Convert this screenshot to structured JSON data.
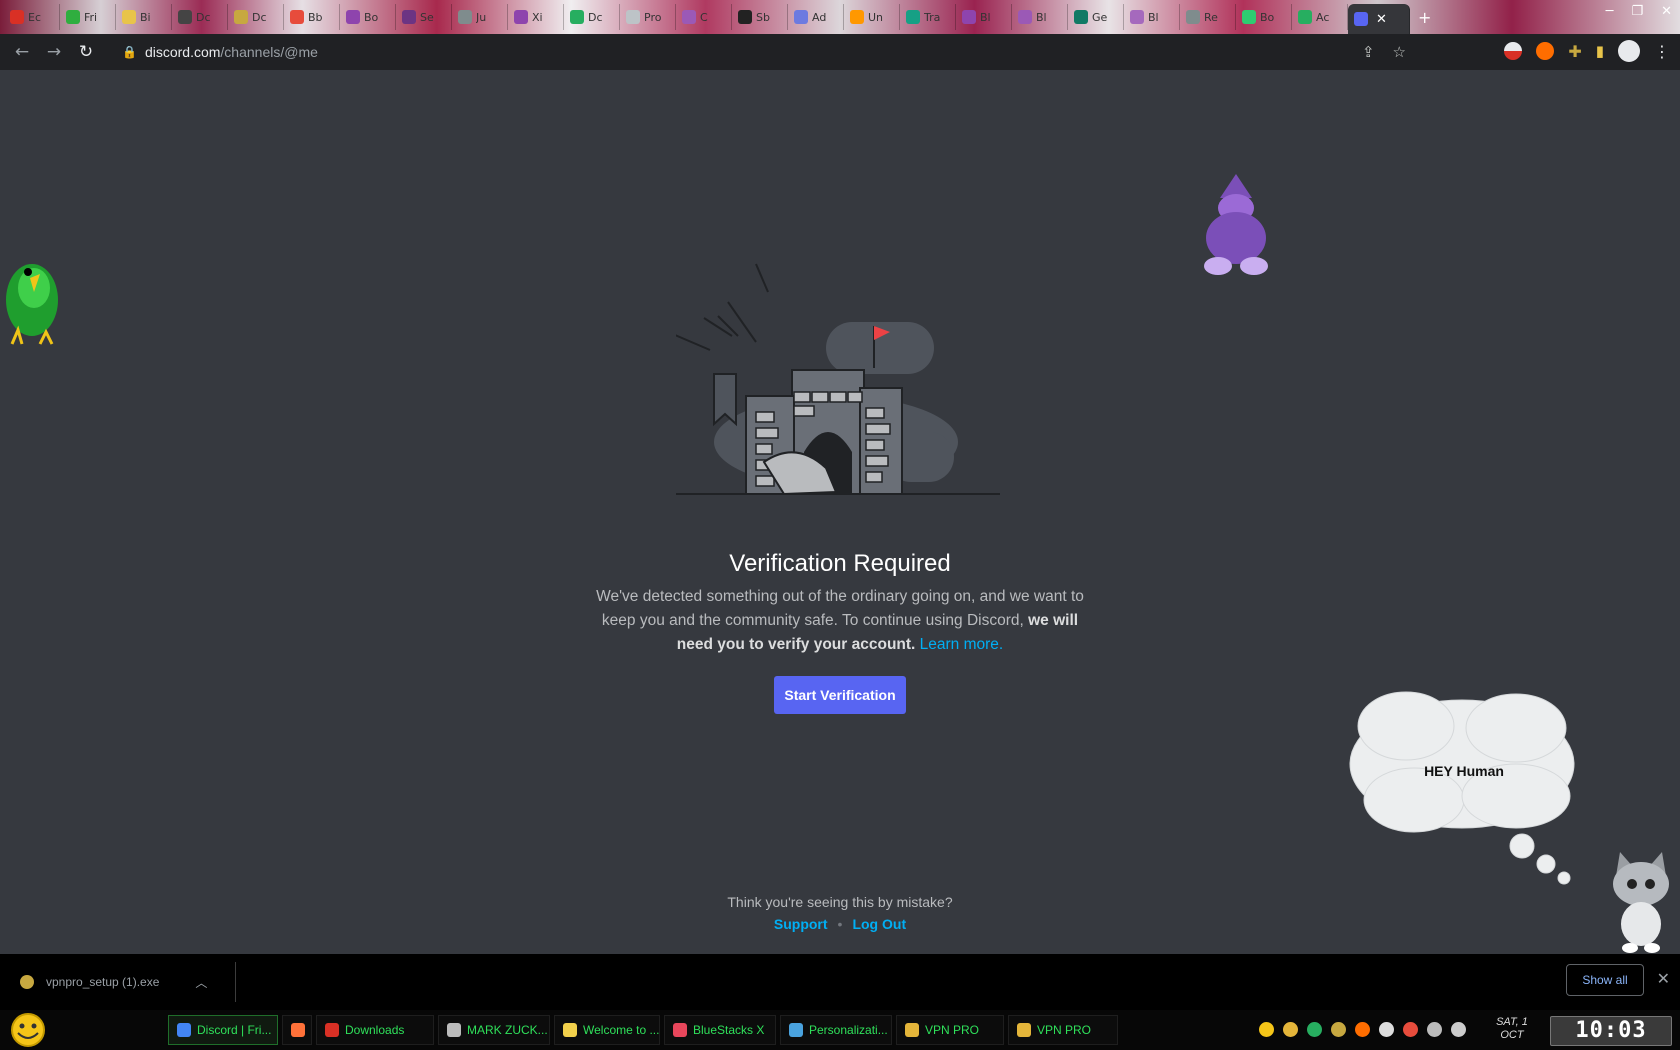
{
  "browser": {
    "tabs": [
      {
        "label": "Ec",
        "color": "#d93025"
      },
      {
        "label": "Fri",
        "color": "#2fae3f"
      },
      {
        "label": "Bi",
        "color": "#e8c44a"
      },
      {
        "label": "Dc",
        "color": "#444444"
      },
      {
        "label": "Dc",
        "color": "#c7a840"
      },
      {
        "label": "Bb",
        "color": "#e74c3c"
      },
      {
        "label": "Bo",
        "color": "#8e44ad"
      },
      {
        "label": "Se",
        "color": "#6c3483"
      },
      {
        "label": "Ju",
        "color": "#7f8c8d"
      },
      {
        "label": "Xi",
        "color": "#8e44ad"
      },
      {
        "label": "Dc",
        "color": "#27ae60"
      },
      {
        "label": "Pro",
        "color": "#bdc3c7"
      },
      {
        "label": "C",
        "color": "#9b59b6"
      },
      {
        "label": "Sb",
        "color": "#222222"
      },
      {
        "label": "Ad",
        "color": "#6c7ae0"
      },
      {
        "label": "Un",
        "color": "#ff9800"
      },
      {
        "label": "Tra",
        "color": "#16a085"
      },
      {
        "label": "Bl",
        "color": "#8e44ad"
      },
      {
        "label": "Bl",
        "color": "#9b59b6"
      },
      {
        "label": "Ge",
        "color": "#117a65"
      },
      {
        "label": "Bl",
        "color": "#a569bd"
      },
      {
        "label": "Re",
        "color": "#7f8c8d"
      },
      {
        "label": "Bo",
        "color": "#2ecc71"
      },
      {
        "label": "Ac",
        "color": "#27ae60"
      }
    ],
    "active_tab": {
      "label": "",
      "color": "#5865f2"
    },
    "url_host": "discord.com",
    "url_path": "/channels/@me"
  },
  "page": {
    "title": "Verification Required",
    "desc_plain": "We've detected something out of the ordinary going on, and we want to keep you and the community safe. To continue using Discord, ",
    "desc_bold": "we will need you to verify your account.",
    "learn_more": "Learn more.",
    "start_button": "Start Verification",
    "mistake_text": "Think you're seeing this by mistake?",
    "support_link": "Support",
    "separator": "•",
    "logout_link": "Log Out"
  },
  "pets": {
    "cloud_text": "HEY Human"
  },
  "downloads": {
    "filename": "vpnpro_setup (1).exe",
    "show_all": "Show all"
  },
  "taskbar": {
    "items": [
      {
        "label": "Discord | Fri...",
        "color": "#4285f4",
        "active": true
      },
      {
        "label": "",
        "color": "#ff7139",
        "active": false
      },
      {
        "label": "Downloads",
        "color": "#d93025",
        "active": false
      },
      {
        "label": "MARK ZUCK...",
        "color": "#bbbbbb",
        "active": false
      },
      {
        "label": "Welcome to ...",
        "color": "#f2d04b",
        "active": false
      },
      {
        "label": "BlueStacks X",
        "color": "#e8465b",
        "active": false
      },
      {
        "label": "Personalizati...",
        "color": "#4aa3df",
        "active": false
      },
      {
        "label": "VPN PRO",
        "color": "#e4b53a",
        "active": false
      },
      {
        "label": "VPN PRO",
        "color": "#e4b53a",
        "active": false
      }
    ],
    "date_line1": "SAT, 1",
    "date_line2": "OCT",
    "time": "10:03"
  }
}
